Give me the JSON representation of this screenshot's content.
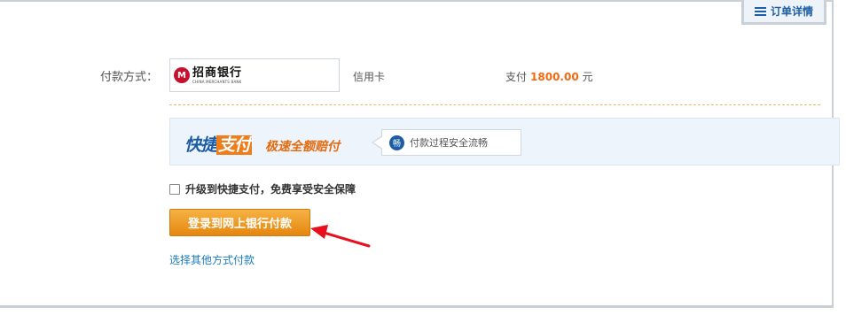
{
  "order_tab": {
    "label": "订单详情",
    "icon": "list-icon"
  },
  "payment": {
    "method_label": "付款方式：",
    "bank": {
      "name_cn": "招商银行",
      "name_en": "CHINA MERCHANTS BANK",
      "logo": "M"
    },
    "card_type": "信用卡",
    "amount_prefix": "支付",
    "amount_value": "1800.00",
    "amount_unit": "元"
  },
  "banner": {
    "brand_part1": "快捷",
    "brand_part2": "支付",
    "slogan": "极速全额赔付",
    "badge": "畅",
    "note": "付款过程安全流畅"
  },
  "upgrade": {
    "label": "升级到快捷支付，免费享受安全保障",
    "checked": false
  },
  "login_button": {
    "label": "登录到网上银行付款"
  },
  "other_link": {
    "label": "选择其他方式付款"
  },
  "colors": {
    "accent": "#f26a10",
    "brand_blue": "#1b5ca4",
    "button_orange": "#ee8f1b",
    "link_blue": "#1c7cc0",
    "arrow_red": "#e8101a"
  }
}
